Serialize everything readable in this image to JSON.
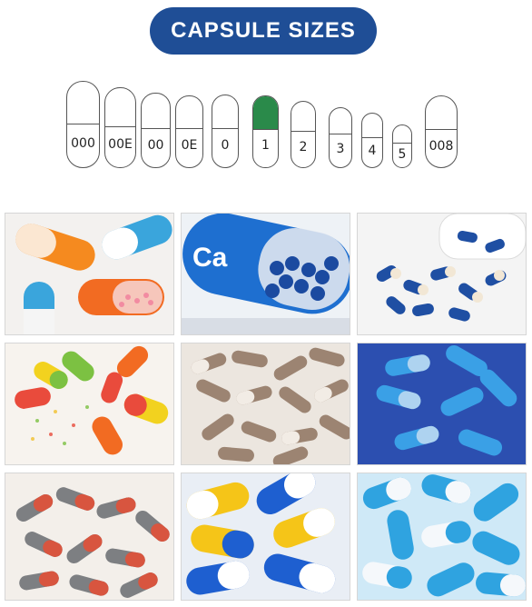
{
  "header": {
    "title": "CAPSULE SIZES"
  },
  "capsule_sizes": [
    {
      "label": "000"
    },
    {
      "label": "00E"
    },
    {
      "label": "00"
    },
    {
      "label": "0E"
    },
    {
      "label": "0"
    },
    {
      "label": "1",
      "highlight_color": "#2a8a4a"
    },
    {
      "label": "2"
    },
    {
      "label": "3"
    },
    {
      "label": "4"
    },
    {
      "label": "5"
    },
    {
      "label": "008"
    }
  ],
  "photos": [
    {
      "name": "orange-blue-capsules-photo"
    },
    {
      "name": "calcium-capsule-photo",
      "text": "Ca"
    },
    {
      "name": "blue-white-bottle-photo"
    },
    {
      "name": "colorful-capsules-photo"
    },
    {
      "name": "brown-capsules-photo"
    },
    {
      "name": "blue-clear-capsules-photo"
    },
    {
      "name": "red-gray-capsules-photo"
    },
    {
      "name": "yellow-blue-capsules-photo"
    },
    {
      "name": "light-blue-capsules-photo"
    }
  ],
  "colors": {
    "title_bg": "#1f4e96",
    "highlight": "#2a8a4a"
  }
}
